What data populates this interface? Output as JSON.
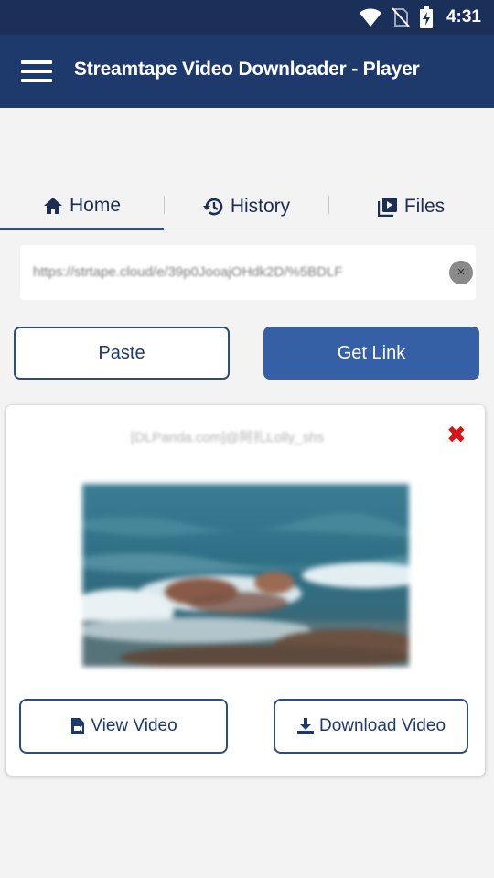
{
  "status_bar": {
    "time": "4:31",
    "icons": [
      "wifi-icon",
      "no-sim-icon",
      "battery-charging-icon"
    ]
  },
  "app_bar": {
    "title": "Streamtape Video Downloader - Player",
    "menu_icon": "hamburger-menu-icon"
  },
  "tabs": [
    {
      "label": "Home",
      "icon": "home-icon",
      "active": true
    },
    {
      "label": "History",
      "icon": "history-icon",
      "active": false
    },
    {
      "label": "Files",
      "icon": "video-library-icon",
      "active": false
    }
  ],
  "url_input": {
    "value": "https://strtape.cloud/e/39p0JooajOHdk2D/%5BDLF"
  },
  "buttons": {
    "paste": "Paste",
    "get_link": "Get Link"
  },
  "video_card": {
    "title": "[DLPanda.com]@阿扎Lolly_shs",
    "view_video": "View Video",
    "download_video": "Download Video"
  },
  "colors": {
    "status_bar": "#1a3059",
    "app_bar": "#1e3a6d",
    "accent": "#3660a6",
    "close": "#e01010"
  }
}
